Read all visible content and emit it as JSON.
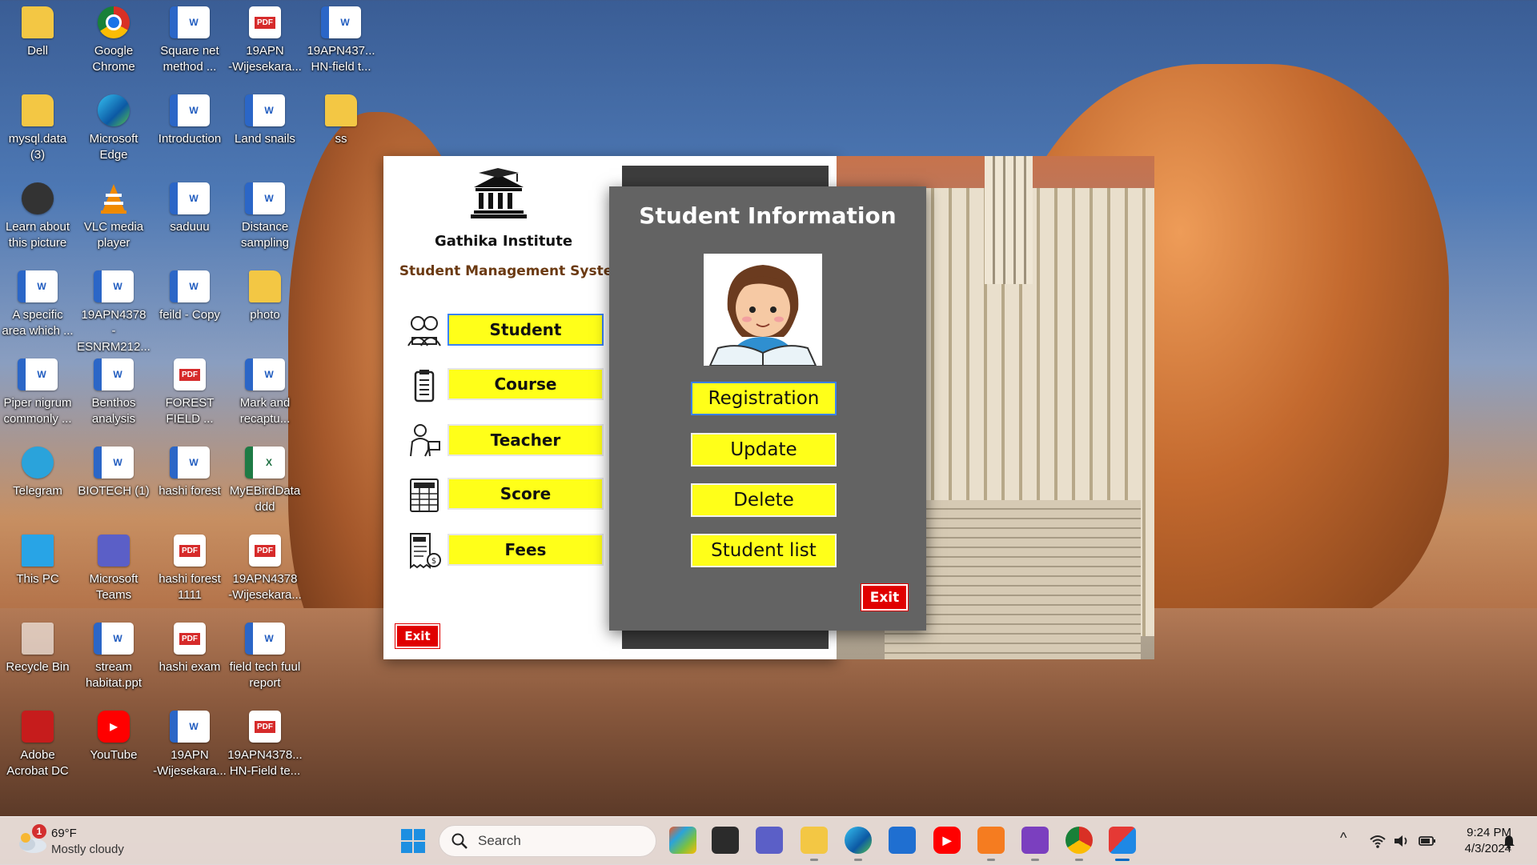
{
  "desktop": {
    "icons": [
      {
        "label": "Dell",
        "type": "folder"
      },
      {
        "label": "Google\nChrome",
        "type": "chrome"
      },
      {
        "label": "Square net\nmethod ...",
        "type": "word"
      },
      {
        "label": "19APN\n-Wijesekara...",
        "type": "pdf"
      },
      {
        "label": "19APN437...\nHN-field t...",
        "type": "word"
      },
      {
        "label": "mysql.data\n(3)",
        "type": "folder"
      },
      {
        "label": "Microsoft\nEdge",
        "type": "edge"
      },
      {
        "label": "Introduction",
        "type": "word"
      },
      {
        "label": "Land snails",
        "type": "word"
      },
      {
        "label": "ss",
        "type": "folder"
      },
      {
        "label": "Learn about\nthis picture",
        "type": "dark"
      },
      {
        "label": "VLC media\nplayer",
        "type": "vlc"
      },
      {
        "label": "saduuu",
        "type": "word"
      },
      {
        "label": "Distance\nsampling",
        "type": "word"
      },
      {
        "label": "A specific\narea which ...",
        "type": "word"
      },
      {
        "label": "19APN4378\n-ESNRM212...",
        "type": "word"
      },
      {
        "label": "feild - Copy",
        "type": "word"
      },
      {
        "label": "photo",
        "type": "folder"
      },
      {
        "label": "Piper nigrum\ncommonly ...",
        "type": "word"
      },
      {
        "label": "Benthos\nanalysis",
        "type": "word"
      },
      {
        "label": "FOREST\nFIELD ...",
        "type": "pdf"
      },
      {
        "label": "Mark and\nrecaptu...",
        "type": "word"
      },
      {
        "label": "Telegram",
        "type": "telegram"
      },
      {
        "label": "BIOTECH (1)",
        "type": "word"
      },
      {
        "label": "hashi forest",
        "type": "word"
      },
      {
        "label": "MyEBirdData\nddd",
        "type": "excel"
      },
      {
        "label": "This PC",
        "type": "pc"
      },
      {
        "label": "Microsoft\nTeams",
        "type": "teams"
      },
      {
        "label": "hashi forest\n1111",
        "type": "pdf"
      },
      {
        "label": "19APN4378\n-Wijesekara...",
        "type": "pdf"
      },
      {
        "label": "Recycle Bin",
        "type": "bin"
      },
      {
        "label": "stream\nhabitat.ppt",
        "type": "word"
      },
      {
        "label": "hashi exam",
        "type": "pdf"
      },
      {
        "label": "field tech fuul\nreport",
        "type": "word"
      },
      {
        "label": "Adobe\nAcrobat DC",
        "type": "acrobat"
      },
      {
        "label": "YouTube",
        "type": "youtube"
      },
      {
        "label": "19APN\n-Wijesekara...",
        "type": "word"
      },
      {
        "label": "19APN4378...\nHN-Field te...",
        "type": "pdf"
      }
    ]
  },
  "main_window": {
    "institute_name": "Gathika Institute",
    "system_name": "Student Management System",
    "nav": [
      {
        "label": "Student",
        "icon": "students-icon"
      },
      {
        "label": "Course",
        "icon": "clipboard-icon"
      },
      {
        "label": "Teacher",
        "icon": "teacher-icon"
      },
      {
        "label": "Score",
        "icon": "score-sheet-icon"
      },
      {
        "label": "Fees",
        "icon": "fee-receipt-icon"
      }
    ],
    "exit_label": "Exit"
  },
  "dialog": {
    "title": "Student Information",
    "buttons": [
      "Registration",
      "Update",
      "Delete",
      "Student list"
    ],
    "exit_label": "Exit"
  },
  "taskbar": {
    "weather": {
      "badge": "1",
      "temp": "69°F",
      "condition": "Mostly cloudy"
    },
    "search_placeholder": "Search",
    "clock": {
      "time": "9:24 PM",
      "date": "4/3/2024"
    },
    "pdf_badge": "PDF",
    "word_badge": "W",
    "excel_badge": "X",
    "youtube_glyph": "▶",
    "tray_up": "^"
  }
}
